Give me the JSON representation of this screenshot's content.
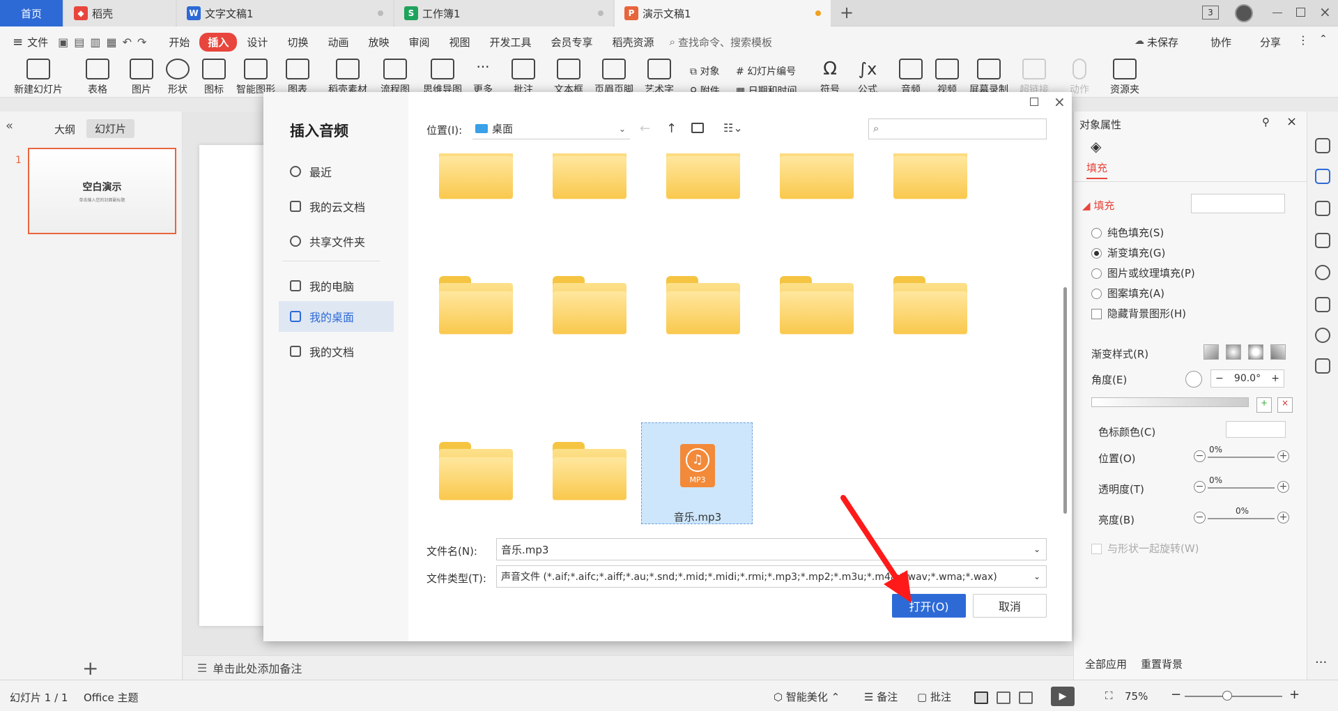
{
  "tabs": [
    {
      "label": "首页",
      "active": true
    },
    {
      "label": "稻壳"
    },
    {
      "label": "文字文稿1"
    },
    {
      "label": "工作簿1"
    },
    {
      "label": "演示文稿1"
    }
  ],
  "tab_badge": "3",
  "menubar": {
    "file": "文件",
    "items": [
      "开始",
      "插入",
      "设计",
      "切换",
      "动画",
      "放映",
      "审阅",
      "视图",
      "开发工具",
      "会员专享",
      "稻壳资源"
    ],
    "search_placeholder": "查找命令、搜索模板",
    "unsaved": "未保存",
    "collab": "协作",
    "share": "分享"
  },
  "ribbon": [
    "新建幻灯片",
    "表格",
    "图片",
    "形状",
    "图标",
    "智能图形",
    "图表",
    "稻壳素材",
    "流程图",
    "思维导图",
    "更多",
    "批注",
    "文本框",
    "页眉页脚",
    "艺术字",
    "对象",
    "附件",
    "幻灯片编号",
    "日期和时间",
    "符号",
    "公式",
    "音频",
    "视频",
    "屏幕录制",
    "超链接",
    "动作",
    "资源夹"
  ],
  "left_panel": {
    "tab_outline": "大纲",
    "tab_slides": "幻灯片",
    "slide_number": "1",
    "thumb_title": "空白演示",
    "thumb_sub": "单击输入您的封面副标题"
  },
  "notes": "单击此处添加备注",
  "dialog": {
    "title": "插入音频",
    "location_label": "位置(I):",
    "location_value": "桌面",
    "nav": [
      "最近",
      "我的云文档",
      "共享文件夹",
      "我的电脑",
      "我的桌面",
      "我的文档"
    ],
    "selected_file": "音乐.mp3",
    "file_badge": "MP3",
    "filename_label": "文件名(N):",
    "filename_value": "音乐.mp3",
    "filetype_label": "文件类型(T):",
    "filetype_value": "声音文件 (*.aif;*.aifc;*.aiff;*.au;*.snd;*.mid;*.midi;*.rmi;*.mp3;*.mp2;*.m3u;*.m4a;*.wav;*.wma;*.wax)",
    "open_button": "打开(O)",
    "cancel_button": "取消"
  },
  "right_panel": {
    "title": "对象属性",
    "fill_tab": "填充",
    "section": "填充",
    "options": [
      "纯色填充(S)",
      "渐变填充(G)",
      "图片或纹理填充(P)",
      "图案填充(A)"
    ],
    "hide_bg": "隐藏背景图形(H)",
    "gradient_style": "渐变样式(R)",
    "angle_label": "角度(E)",
    "angle_value": "90.0°",
    "color_stop": "色标颜色(C)",
    "position": "位置(O)",
    "transparency": "透明度(T)",
    "brightness": "亮度(B)",
    "pct": "0%",
    "rotate_with_shape": "与形状一起旋转(W)",
    "apply_all": "全部应用",
    "reset_bg": "重置背景"
  },
  "statusbar": {
    "slide_info": "幻灯片 1 / 1",
    "theme": "Office 主题",
    "beautify": "智能美化",
    "notes": "备注",
    "comments": "批注",
    "zoom": "75%"
  },
  "colors": {
    "accent": "#e8453c",
    "primary_button": "#2d6ad6",
    "selected_nav": "#dfe7f3"
  }
}
